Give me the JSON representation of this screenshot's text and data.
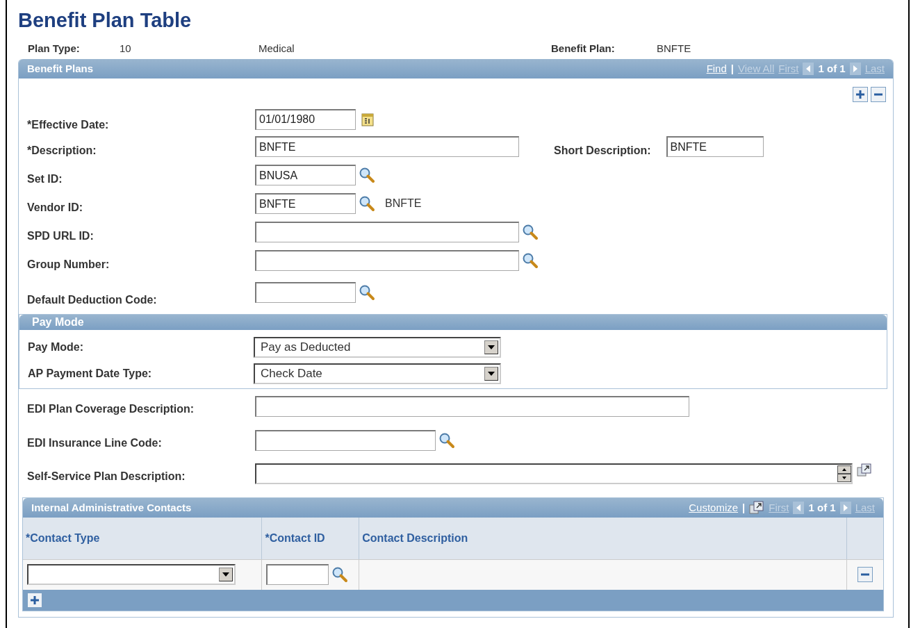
{
  "title": "Benefit Plan Table",
  "header": {
    "plan_type_label": "Plan Type:",
    "plan_type_value": "10",
    "plan_type_desc": "Medical",
    "benefit_plan_label": "Benefit Plan:",
    "benefit_plan_value": "BNFTE"
  },
  "benefit_plans": {
    "title": "Benefit Plans",
    "nav": [
      {
        "kind": "link",
        "text": "Find",
        "disabled": false
      },
      {
        "kind": "sep",
        "text": "|"
      },
      {
        "kind": "link",
        "text": "View All",
        "disabled": true
      },
      {
        "kind": "link",
        "text": "First",
        "disabled": true
      },
      {
        "kind": "prev"
      },
      {
        "kind": "count",
        "text": "1 of 1"
      },
      {
        "kind": "next"
      },
      {
        "kind": "link",
        "text": "Last",
        "disabled": true
      }
    ],
    "fields": [
      {
        "label": "*Effective Date:",
        "value": "01/01/1980",
        "kind": "date"
      },
      {
        "label": "*Description:",
        "value": "BNFTE",
        "kind": "text",
        "side_label": "Short Description:",
        "side_value": "BNFTE"
      },
      {
        "label": "Set ID:",
        "value": "BNUSA",
        "kind": "lookup"
      },
      {
        "label": "Vendor ID:",
        "value": "BNFTE",
        "kind": "lookup",
        "related": "BNFTE"
      },
      {
        "label": "SPD URL ID:",
        "kind": "lookup"
      },
      {
        "label": "Group Number:",
        "kind": "lookup"
      },
      {
        "label": "Default Deduction Code:",
        "kind": "lookup"
      }
    ],
    "pay_mode": {
      "title": "Pay Mode",
      "fields": [
        {
          "label": "Pay Mode:",
          "value": "Pay as Deducted"
        },
        {
          "label": "AP Payment Date Type:",
          "value": "Check Date"
        }
      ]
    },
    "edi_fields": [
      {
        "label": "EDI Plan Coverage Description:",
        "kind": "text"
      },
      {
        "label": "EDI Insurance Line Code:",
        "kind": "lookup"
      },
      {
        "label": "Self-Service Plan Description:",
        "kind": "longtext"
      }
    ],
    "contacts": {
      "title": "Internal Administrative Contacts",
      "nav": [
        {
          "kind": "link",
          "text": "Customize",
          "disabled": false
        },
        {
          "kind": "sep",
          "text": "|"
        },
        {
          "kind": "expand"
        },
        {
          "kind": "link",
          "text": "First",
          "disabled": true
        },
        {
          "kind": "prev"
        },
        {
          "kind": "count",
          "text": "1 of 1"
        },
        {
          "kind": "next"
        },
        {
          "kind": "link",
          "text": "Last",
          "disabled": true
        }
      ],
      "columns": [
        "*Contact Type",
        "*Contact ID",
        "Contact Description"
      ],
      "rows": [
        {
          "contact_type": "",
          "contact_id": ""
        }
      ]
    }
  }
}
